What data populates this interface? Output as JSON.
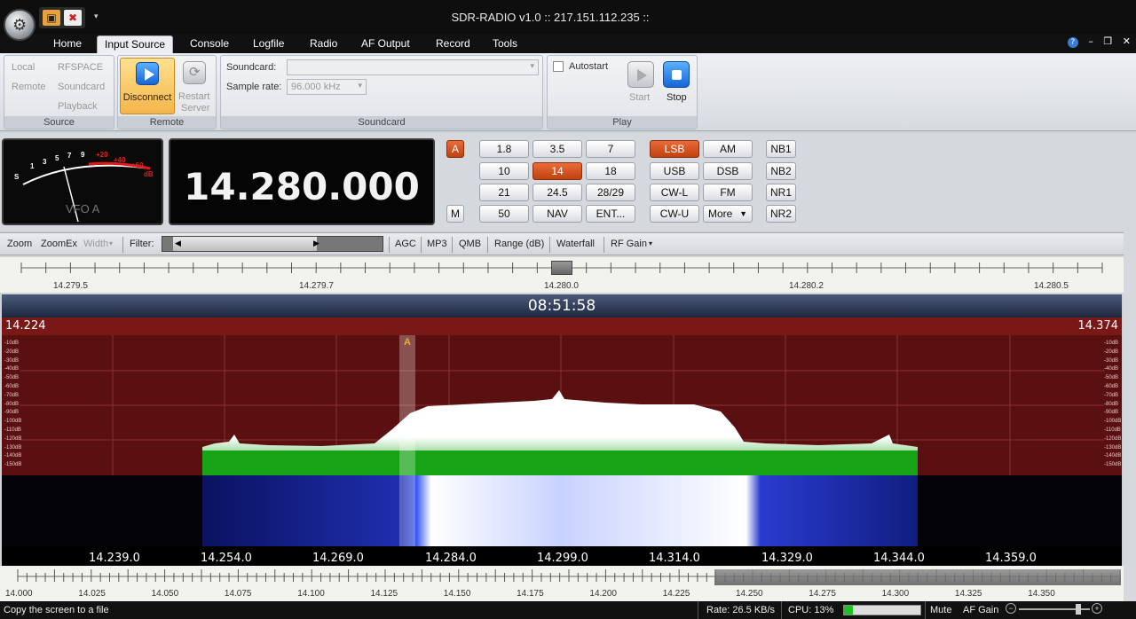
{
  "window": {
    "title": "SDR-RADIO v1.0 :: 217.151.112.235 ::",
    "help_icon": "help-icon",
    "controls": [
      "minimize-icon",
      "restore-icon",
      "close-icon"
    ]
  },
  "tabs": [
    "Home",
    "Input Source",
    "Console",
    "Logfile",
    "Radio",
    "AF Output",
    "Record",
    "Tools"
  ],
  "active_tab": "Input Source",
  "ribbon": {
    "source": {
      "label": "Source",
      "items": [
        "Local",
        "Remote",
        "RFSPACE",
        "Soundcard",
        "Playback"
      ]
    },
    "remote": {
      "label": "Remote",
      "disconnect": "Disconnect",
      "restart_1": "Restart",
      "restart_2": "Server"
    },
    "soundcard": {
      "label": "Soundcard",
      "soundcard_label": "Soundcard:",
      "soundcard_value": "",
      "sample_rate_label": "Sample rate:",
      "sample_rate_value": "96.000 kHz"
    },
    "play": {
      "label": "Play",
      "autostart": "Autostart",
      "start": "Start",
      "stop": "Stop"
    }
  },
  "meter": {
    "scale": [
      "S",
      "1",
      "3",
      "5",
      "7",
      "9",
      "+20",
      "+40",
      "+60",
      "dB"
    ],
    "vfo": "VFO A"
  },
  "frequency": "14.280.000",
  "vfo_buttons": {
    "a": "A",
    "m": "M"
  },
  "bands": [
    "1.8",
    "3.5",
    "7",
    "10",
    "14",
    "18",
    "21",
    "24.5",
    "28/29",
    "50",
    "NAV",
    "ENT..."
  ],
  "active_band": "14",
  "modes": [
    "LSB",
    "AM",
    "USB",
    "DSB",
    "CW-L",
    "FM",
    "CW-U",
    "More"
  ],
  "active_mode": "LSB",
  "noise": [
    "NB1",
    "NB2",
    "NR1",
    "NR2"
  ],
  "toolbar": {
    "zoom": "Zoom",
    "zoomex": "ZoomEx",
    "width": "Width",
    "filter": "Filter:",
    "agc": "AGC",
    "mp3": "MP3",
    "qmb": "QMB",
    "range": "Range (dB)",
    "waterfall": "Waterfall",
    "rf_gain": "RF Gain"
  },
  "top_ruler": [
    "14.279.5",
    "14.279.7",
    "14.280.0",
    "14.280.2",
    "14.280.5"
  ],
  "time": "08:51:58",
  "spectrum": {
    "left_freq": "14.224",
    "right_freq": "14.374",
    "db_scale": [
      "-10dB",
      "-20dB",
      "-30dB",
      "-40dB",
      "-50dB",
      "-60dB",
      "-70dB",
      "-80dB",
      "-90dB",
      "-100dB",
      "-110dB",
      "-120dB",
      "-130dB",
      "-140dB",
      "-150dB"
    ],
    "vfo_marker": "A"
  },
  "freq_axis": [
    "14.239.0",
    "14.254.0",
    "14.269.0",
    "14.284.0",
    "14.299.0",
    "14.314.0",
    "14.329.0",
    "14.344.0",
    "14.359.0"
  ],
  "overview_axis": [
    "14.000",
    "14.025",
    "14.050",
    "14.075",
    "14.100",
    "14.125",
    "14.150",
    "14.175",
    "14.200",
    "14.225",
    "14.250",
    "14.275",
    "14.300",
    "14.325",
    "14.350"
  ],
  "status": {
    "hint": "Copy the screen to a file",
    "rate": "Rate: 26.5 KB/s",
    "cpu": "CPU: 13%",
    "mute": "Mute",
    "af_gain": "AF Gain"
  },
  "colors": {
    "accent": "#d0501c",
    "spectrum_fill": "#1fa81f",
    "waterfall": "#1b2a9a"
  }
}
